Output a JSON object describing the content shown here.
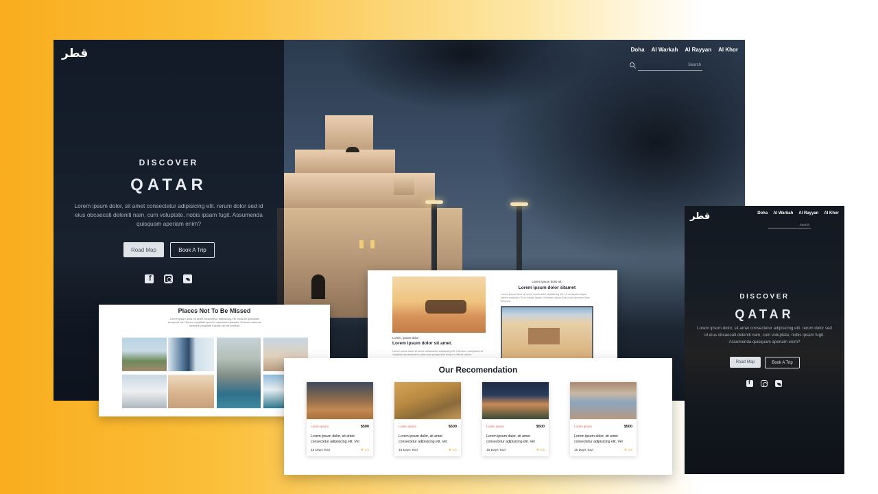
{
  "hero": {
    "logo": "قطر",
    "nav": [
      "Doha",
      "Al Warkah",
      "Al Rayyan",
      "Al Khor"
    ],
    "search_placeholder": "Search",
    "discover": "DISCOVER",
    "title": "QATAR",
    "lorem": "Lorem ipsum dolor, sit amet consectetur adipisicing elit. rerum dolor sed id eius obcaecati deleniti nam, cum voluptate, nobis ipsam fugit. Assumenda quisquam aperiam enim?",
    "btn_roadmap": "Road Map",
    "btn_book": "Book A Trip",
    "social_icons": [
      "facebook-icon",
      "instagram-icon",
      "twitter-icon"
    ]
  },
  "places": {
    "title": "Places Not To Be Missed",
    "subtitle": "Lorem ipsum dolor sit amet consectetur adipisicing elit. Incidunt quisquam excepturi vel? Nemo cupiditate quod et asperiores pariatur. Dolorem laborum ducimus voluptate Facere vel est incidunt."
  },
  "article": {
    "left_small": "Lorem, ipsum dolor",
    "left_title": "Lorem ipsum dolor sit amet.",
    "left_body": "Lorem ipsum dolor sit amet consectetur adipisicing elit. Laborum voluptatum at Sapiente reprehenderit, vitae ipsa perspiciatis tempora officiis dolore.",
    "right_small": "Lorem ipsum dolor sit.",
    "right_title": "Lorem ipsum dolor sitamet",
    "right_body": "Lorem ipsum dolor sit amet consectetur adipisicing elit. Ut quisquam atque labore explicabo Error eaque Ipsam, Molestim atque Eius dolor Aperiam illum tempore."
  },
  "recommendation": {
    "title": "Our Recomendation",
    "cards": [
      {
        "location": "Lorem ipsum",
        "price": "$500",
        "desc": "Lorem ipsum dolor, sit amet consectetur adipisicing elit. Vel",
        "days": "15 Days Tour",
        "rating": "★ 4.6"
      },
      {
        "location": "Lorem ipsum",
        "price": "$500",
        "desc": "Lorem ipsum dolor, sit amet consectetur adipisicing elit. Vel",
        "days": "15 Days Tour",
        "rating": "★ 4.6"
      },
      {
        "location": "Lorem ipsum",
        "price": "$500",
        "desc": "Lorem ipsum dolor, sit amet consectetur adipisicing elit. Vel",
        "days": "15 Days Tour",
        "rating": "★ 4.6"
      },
      {
        "location": "Lorem ipsum",
        "price": "$500",
        "desc": "Lorem ipsum dolor, sit amet consectetur adipisicing elit. Vel",
        "days": "15 Days Tour",
        "rating": "★ 4.6"
      }
    ]
  },
  "mobile": {
    "logo": "قطر",
    "nav": [
      "Doha",
      "Al Warkah",
      "Al Rayyan",
      "Al Khor"
    ],
    "search_placeholder": "Search",
    "discover": "DISCOVER",
    "title": "QATAR",
    "lorem": "Lorem ipsum dolor, sit amet consectetur adipisicing elit. rerum dolor sed id eius obcaecati deleniti nam, cum voluptate, nobis ipsam fugit. Assumenda quisquam aperiam enim?",
    "btn_roadmap": "Road Map",
    "btn_book": "Book A Trip"
  },
  "colors": {
    "background_gradient_start": "#f9ad1e",
    "panel_dark": "#0d141e",
    "button_light": "#dfe3e8",
    "accent_location": "#ee5555",
    "rating_star": "#f5a623"
  }
}
